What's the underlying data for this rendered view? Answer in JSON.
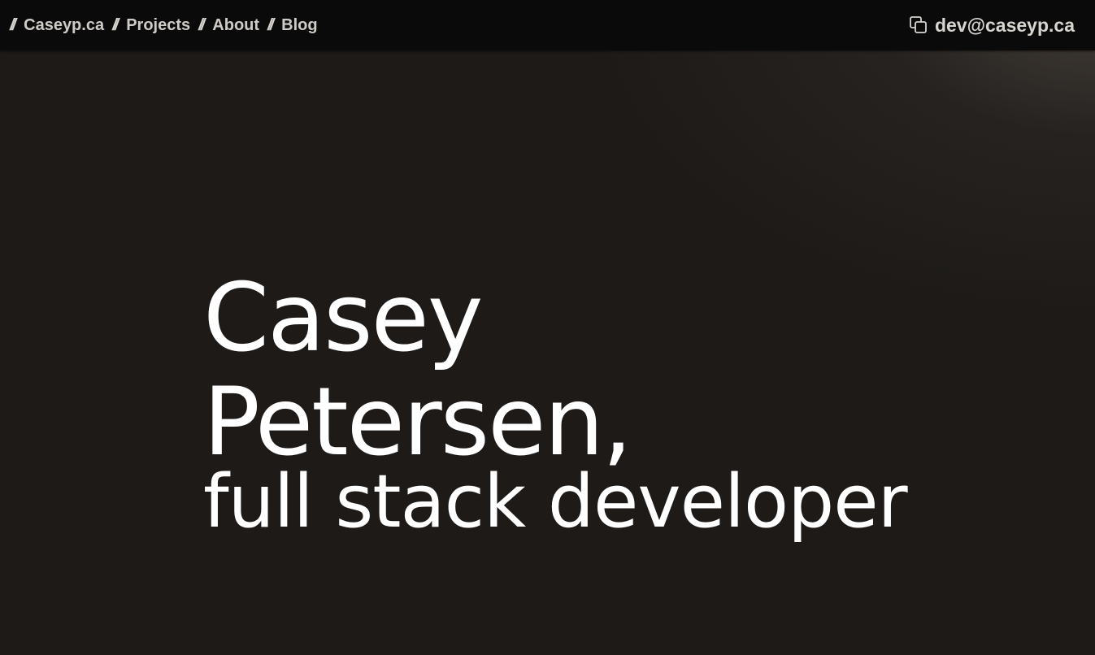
{
  "nav": {
    "separator": "//",
    "items": [
      {
        "label": "Caseyp.ca"
      },
      {
        "label": "Projects"
      },
      {
        "label": "About"
      },
      {
        "label": "Blog"
      }
    ]
  },
  "contact": {
    "icon": "copy-icon",
    "email": "dev@caseyp.ca"
  },
  "hero": {
    "line1": "Casey",
    "line2": "Petersen,",
    "line3": "full stack developer"
  },
  "colors": {
    "background": "#1d1a18",
    "topbar": "#0b0a0a",
    "text": "#ffffff",
    "nav_text": "#cfcbc7"
  }
}
